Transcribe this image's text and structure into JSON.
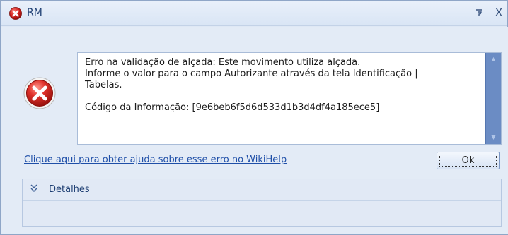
{
  "window": {
    "title": "RM",
    "help_glyph": "‽",
    "close_glyph": "X"
  },
  "message": {
    "text": "Erro na validação de alçada: Este movimento utiliza alçada.\nInforme o valor para o campo Autorizante através da tela Identificação |\nTabelas.\n\nCódigo da Informação: [9e6beb6f5d6d533d1b3d4df4a185ece5]"
  },
  "help_link": {
    "label": "Clique aqui para obter ajuda sobre esse erro no WikiHelp"
  },
  "buttons": {
    "ok_label": "Ok"
  },
  "details": {
    "label": "Detalhes"
  },
  "icons": {
    "title_icon": "error-icon",
    "main_icon": "error-icon",
    "details_toggle": "double-chevron-down-icon"
  },
  "colors": {
    "error_red": "#d0201c",
    "accent_blue": "#1f4fa8",
    "scrollbar_blue": "#6b8cc4"
  }
}
